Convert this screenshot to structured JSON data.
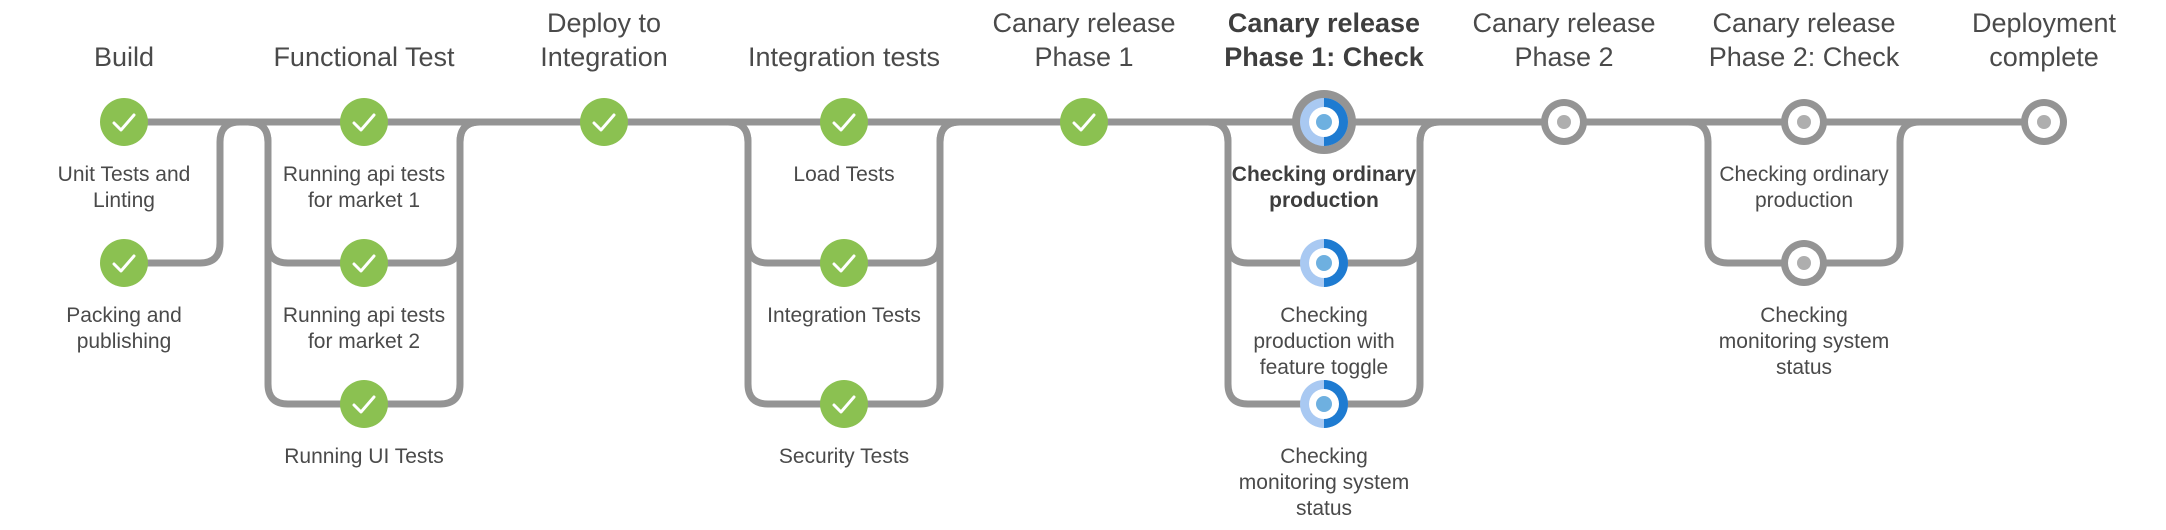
{
  "pipeline": {
    "colors": {
      "connector": "#949494",
      "success": "#8bc151",
      "running_light": "#a9c9f2",
      "running_dark": "#1e7bd1",
      "running_dot": "#6eb0e0",
      "not_started_dot": "#aeaeae",
      "text": "#4a4a4a"
    },
    "stages": [
      {
        "title": "Build",
        "selected": false,
        "nodes": [
          {
            "label": "Unit Tests and Linting",
            "status": "success"
          },
          {
            "label": "Packing and publishing",
            "status": "success"
          }
        ]
      },
      {
        "title": "Functional Test",
        "selected": false,
        "nodes": [
          {
            "label": "Running api tests for market 1",
            "status": "success"
          },
          {
            "label": "Running api tests for market 2",
            "status": "success"
          },
          {
            "label": "Running UI Tests",
            "status": "success"
          }
        ]
      },
      {
        "title": "Deploy to Integration",
        "selected": false,
        "nodes": [
          {
            "label": "",
            "status": "success"
          }
        ]
      },
      {
        "title": "Integration tests",
        "selected": false,
        "nodes": [
          {
            "label": "Load Tests",
            "status": "success"
          },
          {
            "label": "Integration Tests",
            "status": "success"
          },
          {
            "label": "Security Tests",
            "status": "success"
          }
        ]
      },
      {
        "title": "Canary release Phase 1",
        "selected": false,
        "nodes": [
          {
            "label": "",
            "status": "success"
          }
        ]
      },
      {
        "title": "Canary release Phase 1: Check",
        "selected": true,
        "nodes": [
          {
            "label": "Checking ordinary production",
            "status": "running",
            "selected": true
          },
          {
            "label": "Checking production with feature toggle",
            "status": "running"
          },
          {
            "label": "Checking monitoring system status",
            "status": "running"
          }
        ]
      },
      {
        "title": "Canary release Phase 2",
        "selected": false,
        "nodes": [
          {
            "label": "",
            "status": "not_started"
          }
        ]
      },
      {
        "title": "Canary release Phase 2: Check",
        "selected": false,
        "nodes": [
          {
            "label": "Checking ordinary production",
            "status": "not_started"
          },
          {
            "label": "Checking monitoring system status",
            "status": "not_started"
          }
        ]
      },
      {
        "title": "Deployment complete",
        "selected": false,
        "nodes": [
          {
            "label": "",
            "status": "not_started"
          }
        ]
      }
    ]
  }
}
